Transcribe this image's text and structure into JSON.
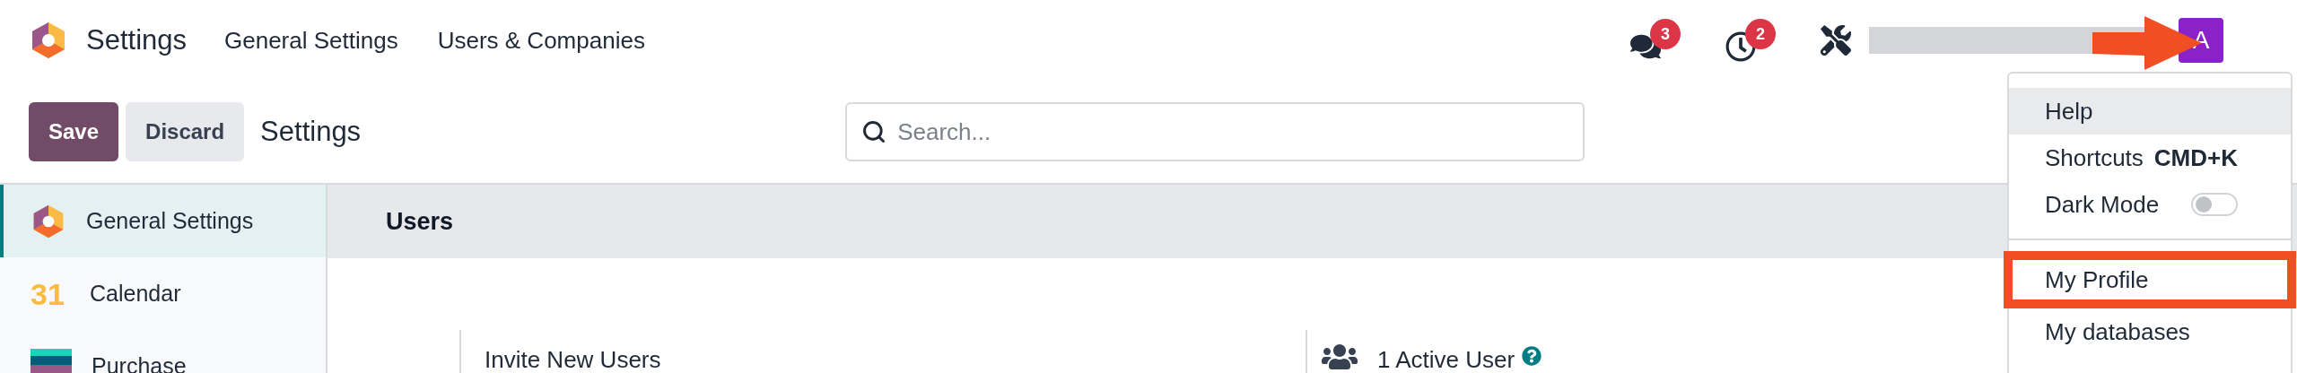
{
  "app": {
    "title": "Settings"
  },
  "nav": [
    {
      "label": "General Settings"
    },
    {
      "label": "Users & Companies"
    }
  ],
  "systray": [
    {
      "kind": "chat",
      "count": "3"
    },
    {
      "kind": "activity",
      "count": "2"
    },
    {
      "kind": "tools"
    }
  ],
  "avatar": {
    "initial": "A"
  },
  "control_panel": {
    "buttons": [
      {
        "label": "Save",
        "kind": "primary"
      },
      {
        "label": "Discard",
        "kind": "secondary"
      }
    ],
    "breadcrumb": "Settings",
    "search": {
      "placeholder": "Search..."
    }
  },
  "sidebar": {
    "items": [
      {
        "label": "General Settings",
        "kind": "logo",
        "selected": true
      },
      {
        "label": "Calendar",
        "kind": "calendar",
        "icon_text": "31",
        "selected": false
      },
      {
        "label": "Purchase",
        "kind": "purchase",
        "selected": false
      }
    ]
  },
  "section": {
    "title": "Users",
    "settings": [
      {
        "label": "Invite New Users",
        "kind": "plain"
      },
      {
        "label": "1 Active User",
        "kind": "users",
        "help": true
      }
    ]
  },
  "user_menu": {
    "items": [
      {
        "kind": "item",
        "label": "Help",
        "hovered": true,
        "annotated": false
      },
      {
        "kind": "shortcut",
        "label": "Shortcuts",
        "shortcut": "CMD+K",
        "hovered": false,
        "annotated": false
      },
      {
        "kind": "toggle",
        "label": "Dark Mode",
        "on": false,
        "hovered": false,
        "annotated": false
      },
      {
        "kind": "divider"
      },
      {
        "kind": "item",
        "label": "My Profile",
        "hovered": false,
        "annotated": true
      },
      {
        "kind": "item",
        "label": "My databases",
        "hovered": false,
        "annotated": false
      }
    ]
  }
}
